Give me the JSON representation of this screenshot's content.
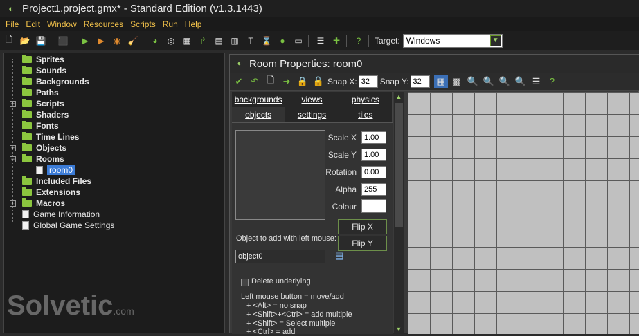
{
  "window": {
    "title": "Project1.project.gmx*  -  Standard Edition (v1.3.1443)"
  },
  "menu": [
    "File",
    "Edit",
    "Window",
    "Resources",
    "Scripts",
    "Run",
    "Help"
  ],
  "toolbar": {
    "target_label": "Target:",
    "target_value": "Windows"
  },
  "tree": {
    "items": [
      "Sprites",
      "Sounds",
      "Backgrounds",
      "Paths",
      "Scripts",
      "Shaders",
      "Fonts",
      "Time Lines",
      "Objects",
      "Rooms",
      "room0",
      "Included Files",
      "Extensions",
      "Macros",
      "Game Information",
      "Global Game Settings"
    ]
  },
  "room": {
    "title": "Room Properties: room0",
    "snap_x_label": "Snap X:",
    "snap_x": "32",
    "snap_y_label": "Snap Y:",
    "snap_y": "32",
    "tabs_row1": [
      "backgrounds",
      "views",
      "physics"
    ],
    "tabs_row2": [
      "objects",
      "settings",
      "tiles"
    ],
    "scale_x_label": "Scale X",
    "scale_x": "1.00",
    "scale_y_label": "Scale Y",
    "scale_y": "1.00",
    "rotation_label": "Rotation",
    "rotation": "0.00",
    "alpha_label": "Alpha",
    "alpha": "255",
    "colour_label": "Colour",
    "flip_x": "Flip X",
    "flip_y": "Flip Y",
    "object_prompt": "Object to add with left mouse:",
    "object_value": "object0",
    "delete_underlying": "Delete underlying",
    "help_lines": [
      "Left mouse button = move/add",
      "+ <Alt> = no snap",
      "+ <Shift>+<Ctrl> = add multiple",
      "+ <Shift> = Select multiple",
      "+ <Ctrl> = add"
    ]
  },
  "watermark": {
    "brand": "Solvetic",
    "suffix": ".com"
  }
}
